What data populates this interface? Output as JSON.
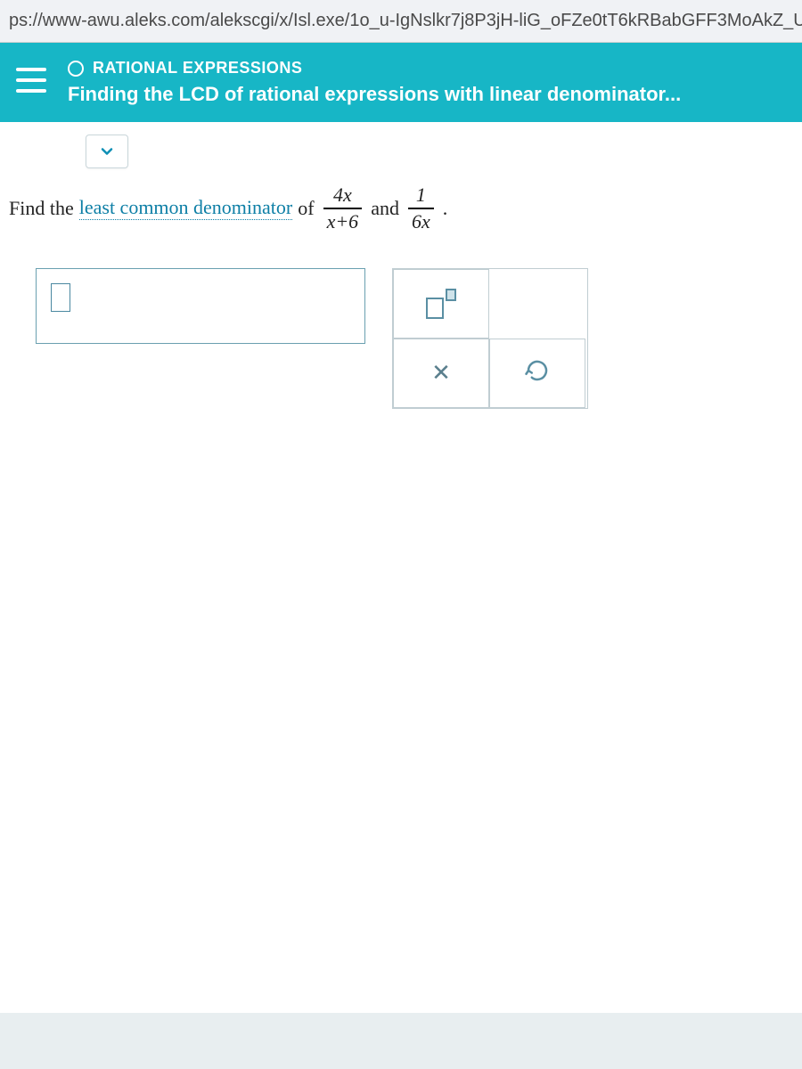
{
  "url": "ps://www-awu.aleks.com/alekscgi/x/Isl.exe/1o_u-IgNslkr7j8P3jH-liG_oFZe0tT6kRBabGFF3MoAkZ_UVxr",
  "header": {
    "slice": "RATIONAL EXPRESSIONS",
    "topic": "Finding the LCD of rational expressions with linear denominator..."
  },
  "question": {
    "prefix": "Find the ",
    "link_text": "least common denominator",
    "mid": " of ",
    "frac1": {
      "num": "4x",
      "den": "x+6"
    },
    "and": " and ",
    "frac2": {
      "num": "1",
      "den": "6x"
    },
    "suffix": "."
  },
  "tools": {
    "exponent_label": "exponent",
    "clear_label": "clear",
    "reset_label": "reset"
  }
}
